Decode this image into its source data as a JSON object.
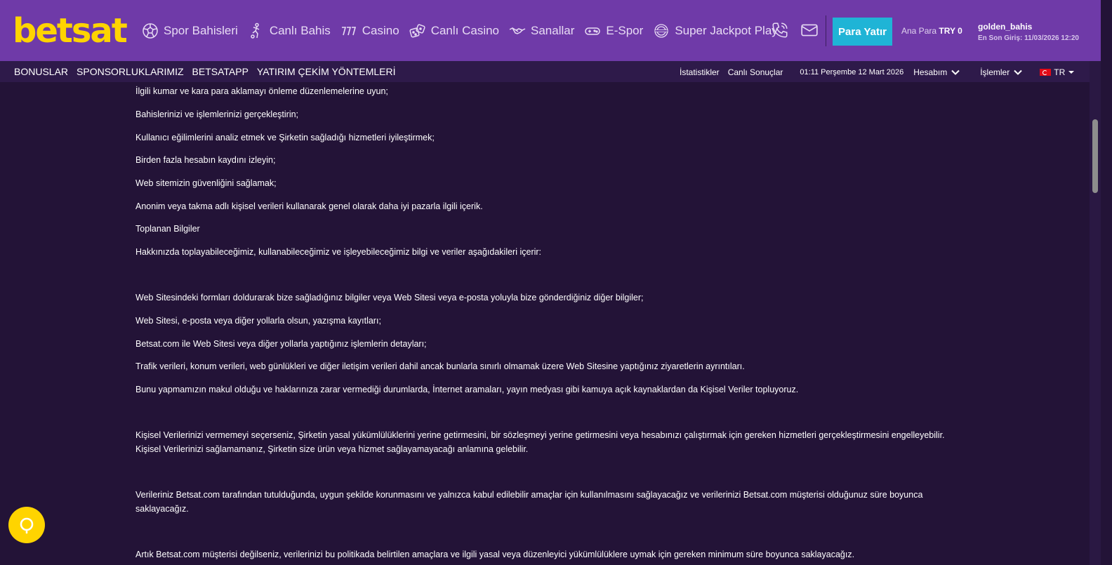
{
  "brand": {
    "logo_text": "betsat",
    "accent_color": "#ffd400",
    "header_bg": "#6f3aa8",
    "page_bg": "#231337"
  },
  "nav": {
    "items": [
      {
        "label": "Spor Bahisleri",
        "icon": "soccer-ball-icon"
      },
      {
        "label": "Canlı Bahis",
        "icon": "player-icon"
      },
      {
        "label": "Casino",
        "icon": "slot-777-icon"
      },
      {
        "label": "Canlı Casino",
        "icon": "dice-icon"
      },
      {
        "label": "Sanallar",
        "icon": "handshake-icon"
      },
      {
        "label": "E-Spor",
        "icon": "gamepad-icon"
      },
      {
        "label": "Super Jackpot Play",
        "icon": "jackpot-badge-icon"
      }
    ]
  },
  "header": {
    "phone_icon": "phone-icon",
    "mail_icon": "mail-icon",
    "deposit_label": "Para Yatır",
    "balance_label": "Ana Para",
    "balance_value": "TRY 0",
    "username": "golden_bahis",
    "last_login": "En Son Giriş: 11/03/2026 12:20"
  },
  "subnav": {
    "left": [
      "BONUSLAR",
      "SPONSORLUKLARIMIZ",
      "BETSATAPP",
      "YATIRIM ÇEKİM YÖNTEMLERİ"
    ],
    "statistics": "İstatistikler",
    "live_results": "Canlı Sonuçlar",
    "datetime": "01:11 Perşembe 12 Mart 2026",
    "account": "Hesabım",
    "transactions": "İşlemler",
    "language": "TR"
  },
  "content": {
    "paragraphs": [
      "İlgili kumar ve kara para aklamayı önleme düzenlemelerine uyun;",
      "Bahislerinizi ve işlemlerinizi gerçekleştirin;",
      "Kullanıcı eğilimlerini analiz etmek ve Şirketin sağladığı hizmetleri iyileştirmek;",
      "Birden fazla hesabın kaydını izleyin;",
      "Web sitemizin güvenliğini sağlamak;",
      "Anonim veya takma adlı kişisel verileri kullanarak genel olarak daha iyi pazarla ilgili içerik.",
      "Toplanan Bilgiler",
      "Hakkınızda toplayabileceğimiz, kullanabileceğimiz ve işleyebileceğimiz bilgi ve veriler aşağıdakileri içerir:",
      "Web Sitesindeki formları doldurarak bize sağladığınız bilgiler veya Web Sitesi veya e-posta yoluyla bize gönderdiğiniz diğer bilgiler;",
      "Web Sitesi, e-posta veya diğer yollarla olsun, yazışma kayıtları;",
      "Betsat.com ile Web Sitesi veya diğer yollarla yaptığınız işlemlerin detayları;",
      "Trafik verileri, konum verileri, web günlükleri ve diğer iletişim verileri dahil ancak bunlarla sınırlı olmamak üzere Web Sitesine yaptığınız ziyaretlerin ayrıntıları.",
      "Bunu yapmamızın makul olduğu ve haklarınıza zarar vermediği durumlarda, İnternet aramaları, yayın medyası gibi kamuya açık kaynaklardan da Kişisel Veriler topluyoruz.",
      "Kişisel Verilerinizi vermemeyi seçerseniz, Şirketin yasal yükümlülüklerini yerine getirmesini, bir sözleşmeyi yerine getirmesini veya hesabınızı çalıştırmak için gereken hizmetleri gerçekleştirmesini engelleyebilir. Kişisel Verilerinizi sağlamamanız, Şirketin size ürün veya hizmet sağlayamayacağı anlamına gelebilir.",
      "Verileriniz Betsat.com tarafından tutulduğunda, uygun şekilde korunmasını ve yalnızca kabul edilebilir amaçlar için kullanılmasını sağlayacağız ve verilerinizi Betsat.com müşterisi olduğunuz süre boyunca saklayacağız.",
      "Artık Betsat.com müşterisi değilseniz, verilerinizi bu politikada belirtilen amaçlara ve ilgili yasal veya düzenleyici yükümlülüklere uymak için gereken minimum süre boyunca saklayacağız."
    ]
  },
  "chat": {
    "icon": "chat-bubble-icon"
  }
}
